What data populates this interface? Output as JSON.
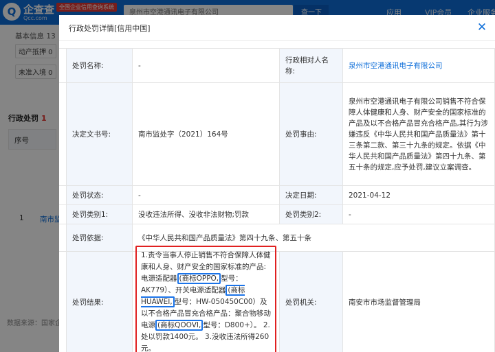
{
  "background": {
    "brand": "企查查",
    "brand_sub": "Qcc.com",
    "badge": "全国企业信用查询系统",
    "search_value": "泉州市空港通讯电子有限公司",
    "search_button": "查一下",
    "nav_app": "应用",
    "nav_vip": "VIP会员",
    "nav_intro": "企业服务",
    "tab_basic": "基本信息",
    "tab_basic_count": "13",
    "chip_1": "动产抵押 0",
    "chip_2": "未准入境 0",
    "section_title": "行政处罚",
    "section_count": "1",
    "col_seq": "序号",
    "row_num": "1",
    "row_link": "南市监",
    "source": "数据来源：国家企业信用信息公示系统"
  },
  "modal": {
    "title": "行政处罚详情[信用中国]",
    "close_glyph": "✕",
    "rows": {
      "penalty_name_label": "处罚名称:",
      "penalty_name_value": "-",
      "counterpart_label": "行政相对人名称:",
      "counterpart_value": "泉州市空港通讯电子有限公司",
      "doc_no_label": "决定文书号:",
      "doc_no_value": "南市监处字（2021）164号",
      "reason_label": "处罚事由:",
      "reason_value": "泉州市空港通讯电子有限公司销售不符合保障人体健康和人身、财产安全的国家标准的产品及以不合格产品冒充合格产品,其行为涉嫌违反《中华人民共和国产品质量法》第十三条第二款、第三十九条的规定。依据《中华人民共和国产品质量法》第四十九条、第五十条的规定,应予处罚,建议立案调查。",
      "status_label": "处罚状态:",
      "status_value": "-",
      "decision_date_label": "决定日期:",
      "decision_date_value": "2021-04-12",
      "category1_label": "处罚类别1:",
      "category1_value": "没收违法所得、没收非法财物;罚款",
      "category2_label": "处罚类别2:",
      "category2_value": "-",
      "basis_label": "处罚依据:",
      "basis_value": "《中华人民共和国产品质量法》第四十九条、第五十条",
      "result_label": "处罚结果:",
      "result_part1": "1.责令当事人停止销售不符合保障人体健康和人身、财产安全的国家标准的产品:电源适配器",
      "result_hl1": "(商标OPPO,",
      "result_part2": "型号：AK779）、开关电源适配器",
      "result_hl2": "(商标HUAWEI,",
      "result_part3": "型号：HW-050450C00）及以不合格产品冒充合格产品：聚合物移动电源",
      "result_hl3": "(商标QOOVI,",
      "result_part4": "型号：D800+）。 2.处以罚款1400元。 3.没收违法所得260元。",
      "authority_label": "处罚机关:",
      "authority_value": "南安市市场监督管理局"
    }
  }
}
